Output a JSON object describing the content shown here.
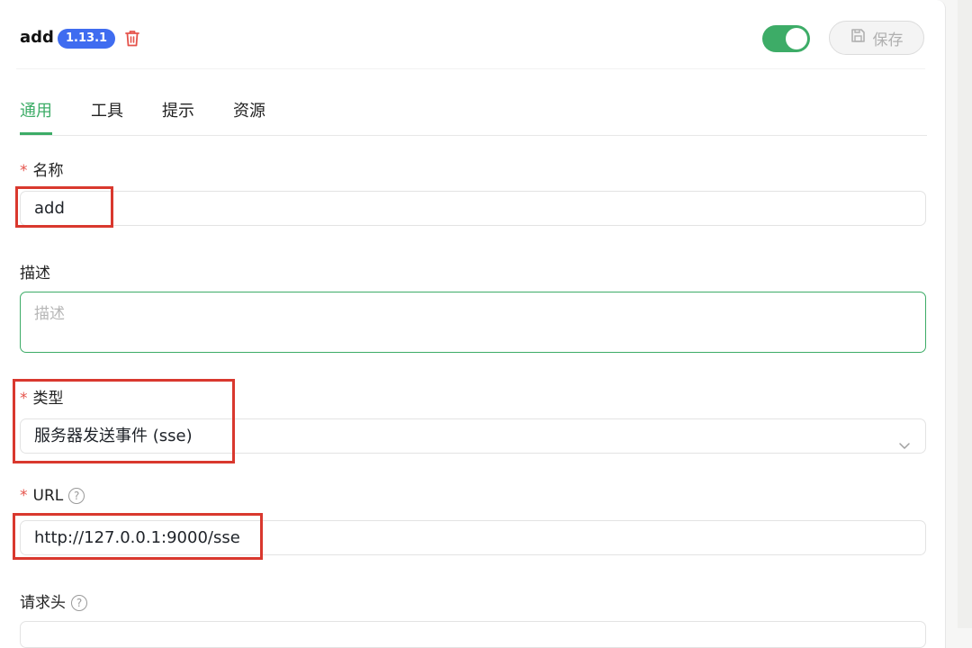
{
  "header": {
    "title": "add",
    "version": "1.13.1",
    "enabled": true,
    "save_label": "保存"
  },
  "tabs": [
    {
      "label": "通用",
      "active": true
    },
    {
      "label": "工具",
      "active": false
    },
    {
      "label": "提示",
      "active": false
    },
    {
      "label": "资源",
      "active": false
    }
  ],
  "form": {
    "name": {
      "label": "名称",
      "required": "*",
      "value": "add"
    },
    "description": {
      "label": "描述",
      "placeholder": "描述",
      "value": ""
    },
    "type": {
      "label": "类型",
      "required": "*",
      "value": "服务器发送事件 (sse)"
    },
    "url": {
      "label": "URL",
      "required": "*",
      "value": "http://127.0.0.1:9000/sse"
    },
    "headers": {
      "label": "请求头"
    }
  },
  "colors": {
    "accent": "#3dac67",
    "badge": "#3f6cf0",
    "danger": "#e5534b",
    "highlight": "#d9382e"
  },
  "icons": {
    "delete": "trash-icon",
    "save": "save-icon",
    "help": "question-circle-icon",
    "select": "chevron-down-icon"
  }
}
